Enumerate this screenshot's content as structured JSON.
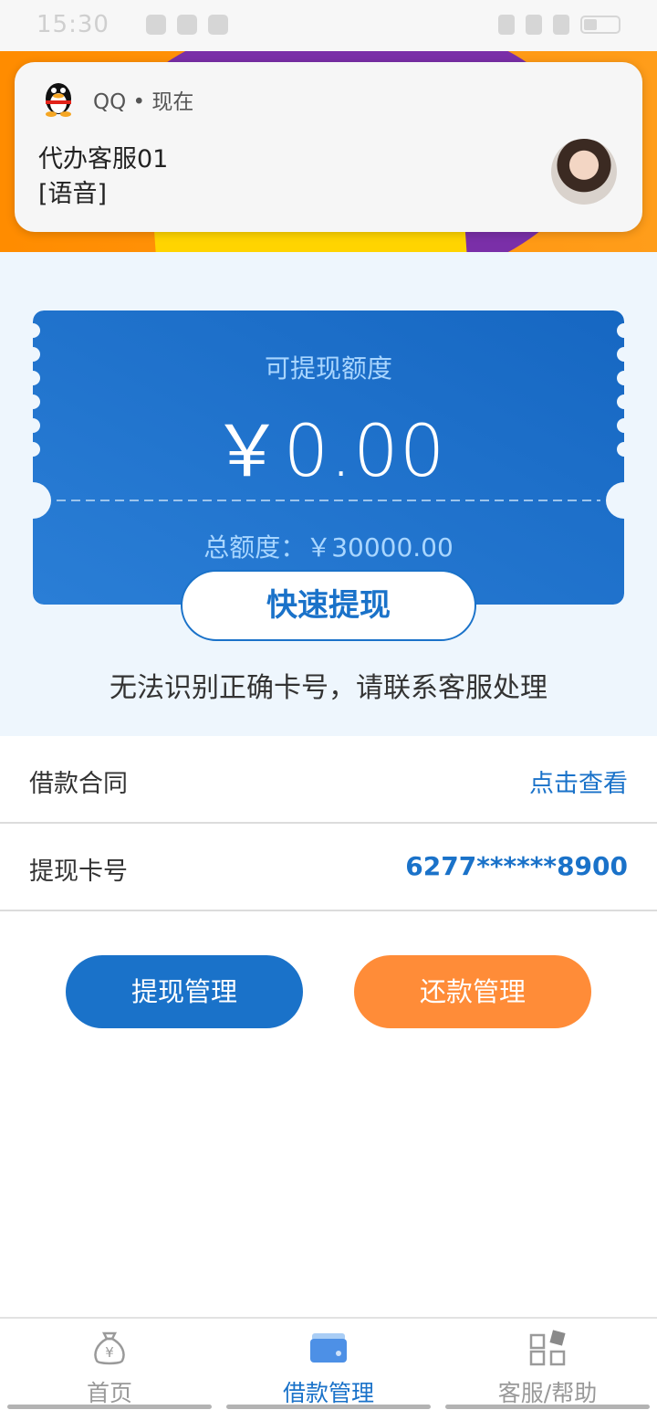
{
  "status_bar": {
    "time": "15:30"
  },
  "notification": {
    "app_name": "QQ",
    "separator": "•",
    "time": "现在",
    "sender": "代办客服01",
    "message": "[语音]"
  },
  "withdraw_card": {
    "label": "可提现额度",
    "amount": "￥0.00",
    "total_label": "总额度：",
    "total_value": "￥30000.00"
  },
  "withdraw_button": "快速提现",
  "warning_text": "无法识别正确卡号，请联系客服处理",
  "rows": [
    {
      "label": "借款合同",
      "value": "点击查看"
    },
    {
      "label": "提现卡号",
      "value": "6277******8900"
    }
  ],
  "actions": {
    "withdraw_manage": "提现管理",
    "repay_manage": "还款管理"
  },
  "tabbar": {
    "tabs": [
      {
        "label": "首页",
        "icon": "money-bag-icon",
        "active": false
      },
      {
        "label": "借款管理",
        "icon": "card-icon",
        "active": true
      },
      {
        "label": "客服/帮助",
        "icon": "grid-icon",
        "active": false
      }
    ]
  },
  "colors": {
    "primary": "#1a72c9",
    "accent_orange": "#ff8c38",
    "light_bg": "#eef6fd"
  }
}
